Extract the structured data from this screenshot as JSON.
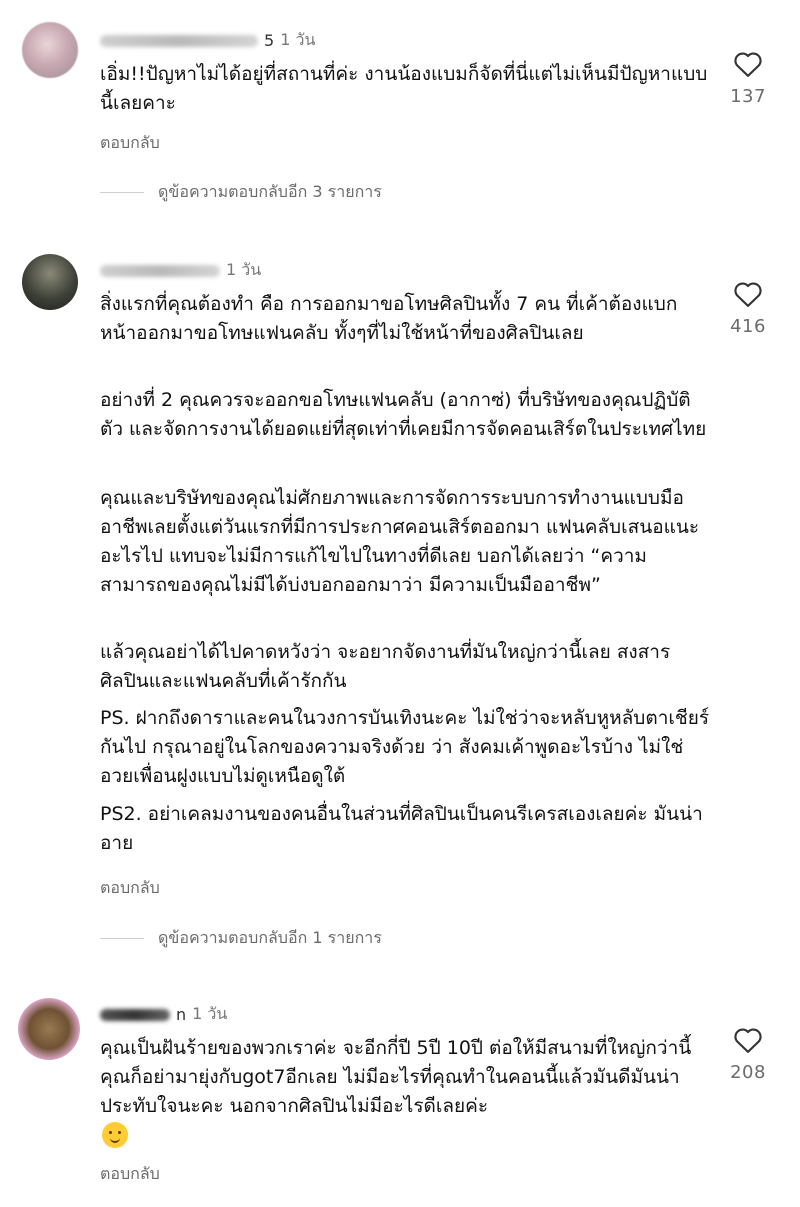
{
  "comments": [
    {
      "time": "1 วัน",
      "name_tail": "5",
      "paragraphs": [
        "เอิ่ม!!ปัญหาไม่ได้อยู่ที่สถานที่ค่ะ งานน้องแบมก็จัดที่นี่แต่ไม่เห็นมีปัญหาแบบนี้เลยคาะ"
      ],
      "reply_label": "ตอบกลับ",
      "view_replies": "ดูข้อความตอบกลับอีก 3 รายการ",
      "likes": "137"
    },
    {
      "time": "1 วัน",
      "name_tail": "",
      "paragraphs": [
        "สิ่งแรกที่คุณต้องทำ คือ การออกมาขอโทษศิลปินทั้ง 7 คน ที่เค้าต้องแบกหน้าออกมาขอโทษแฟนคลับ ทั้งๆที่ไม่ใช้หน้าที่ของศิลปินเลย",
        "อย่างที่ 2 คุณควรจะออกขอโทษแฟนคลับ (อากาซ่) ที่บริษัทของคุณปฏิบัติตัว และจัดการงานได้ยอดแย่ที่สุดเท่าที่เคยมีการจัดคอนเสิร์ตในประเทศไทย",
        "คุณและบริษัทของคุณไม่ศักยภาพและการจัดการระบบการทำงานแบบมืออาชีพเลยตั้งแต่วันแรกที่มีการประกาศคอนเสิร์ตออกมา แฟนคลับเสนอแนะอะไรไป แทบจะไม่มีการแก้ไขไปในทางที่ดีเลย บอกได้เลยว่า “ความสามารถของคุณไม่มีได้บ่งบอกออกมาว่า มีความเป็นมืออาชีพ”",
        "แล้วคุณอย่าได้ไปคาดหวังว่า จะอยากจัดงานที่มันใหญ่กว่านี้เลย สงสารศิลปินและแฟนคลับที่เค้ารักกัน",
        "PS. ฝากถึงดาราและคนในวงการบันเทิงนะคะ ไม่ใช่ว่าจะหลับหูหลับตาเชียร์กันไป กรุณาอยู่ในโลกของความจริงด้วย ว่า สังคมเค้าพูดอะไรบ้าง ไม่ใช่อวยเพื่อนฝูงแบบไม่ดูเหนือดูใต้",
        "PS2. อย่าเคลมงานของคนอื่นในส่วนที่ศิลปินเป็นคนรีเครสเองเลยค่ะ มันน่าอาย"
      ],
      "reply_label": "ตอบกลับ",
      "view_replies": "ดูข้อความตอบกลับอีก 1 รายการ",
      "likes": "416"
    },
    {
      "time": "1 วัน",
      "name_tail": "n",
      "paragraphs": [
        "คุณเป็นฝันร้ายของพวกเราค่ะ  จะอีกกี่ปี 5ปี 10ปี ต่อให้มีสนามที่ใหญ่กว่านี้คุณก็อย่ามายุ่งกับgot7อีกเลย ไม่มีอะไรที่คุณทำในคอนนี้แล้วมันดีมันน่าประทับใจนะคะ นอกจากศิลปินไม่มีอะไรดีเลยค่ะ"
      ],
      "emoji": "thinking-face-emoji",
      "reply_label": "ตอบกลับ",
      "likes": "208"
    }
  ],
  "icons": {
    "like": "heart-outline-icon"
  }
}
